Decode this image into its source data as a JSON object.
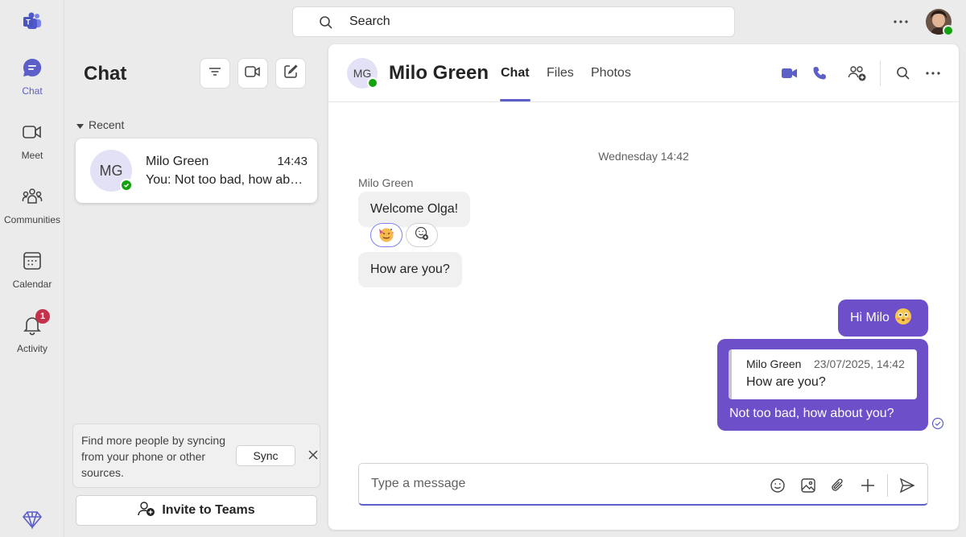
{
  "rail": {
    "items": [
      {
        "label": "Chat",
        "icon": "chat-icon",
        "active": true
      },
      {
        "label": "Meet",
        "icon": "video-camera-icon"
      },
      {
        "label": "Communities",
        "icon": "communities-icon"
      },
      {
        "label": "Calendar",
        "icon": "calendar-icon"
      },
      {
        "label": "Activity",
        "icon": "bell-icon",
        "badge": "1"
      }
    ]
  },
  "search": {
    "placeholder": "Search"
  },
  "chat_list": {
    "title": "Chat",
    "recent_label": "Recent",
    "items": [
      {
        "initials": "MG",
        "name": "Milo Green",
        "time": "14:43",
        "preview": "You: Not too bad, how about you?"
      }
    ],
    "sync": {
      "text": "Find more people by syncing from your phone or other sources.",
      "button": "Sync"
    },
    "invite": "Invite to Teams"
  },
  "conversation": {
    "initials": "MG",
    "name": "Milo Green",
    "tabs": [
      "Chat",
      "Files",
      "Photos"
    ],
    "date_separator": "Wednesday 14:42",
    "sender": "Milo Green",
    "incoming": [
      "Welcome Olga!",
      "How are you?"
    ],
    "outgoing": {
      "first": "Hi Milo",
      "reply": {
        "quote_name": "Milo Green",
        "quote_time": "23/07/2025, 14:42",
        "quote_text": "How are you?",
        "text": "Not too bad, how about you?"
      }
    },
    "compose_placeholder": "Type a message"
  },
  "colors": {
    "accent": "#5b5fc7",
    "outgoing_bubble": "#6d4fc9",
    "presence": "#13a10e",
    "badge": "#c4314b"
  }
}
